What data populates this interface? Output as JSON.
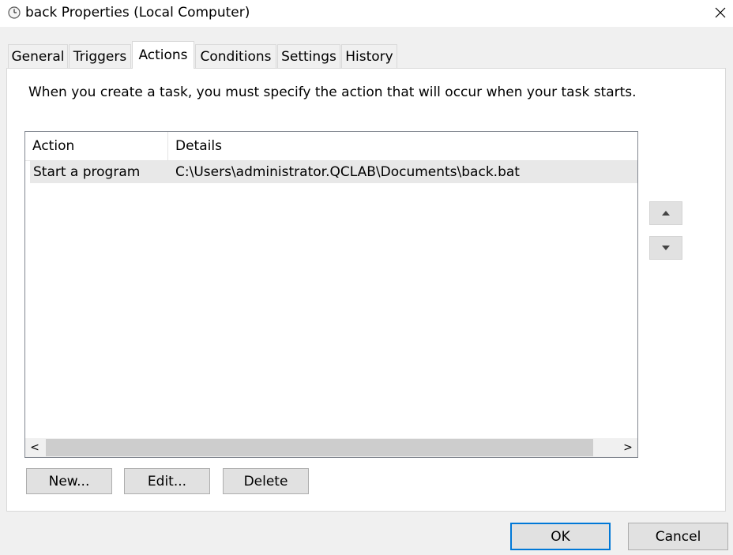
{
  "window": {
    "title": "back Properties (Local Computer)",
    "close_glyph": "✕"
  },
  "tabs": [
    {
      "label": "General"
    },
    {
      "label": "Triggers"
    },
    {
      "label": "Actions",
      "active": true
    },
    {
      "label": "Conditions"
    },
    {
      "label": "Settings"
    },
    {
      "label": "History"
    }
  ],
  "panel": {
    "description": "When you create a task, you must specify the action that will occur when your task starts."
  },
  "actions_list": {
    "columns": [
      "Action",
      "Details"
    ],
    "rows": [
      {
        "action": "Start a program",
        "details": "C:\\Users\\administrator.QCLAB\\Documents\\back.bat"
      }
    ],
    "scroll_left_glyph": "<",
    "scroll_right_glyph": ">"
  },
  "buttons": {
    "new": "New...",
    "edit": "Edit...",
    "delete": "Delete",
    "ok": "OK",
    "cancel": "Cancel"
  },
  "icons": {
    "title": "clock-icon",
    "move_up": "triangle-up-icon",
    "move_down": "triangle-down-icon"
  },
  "colors": {
    "accent": "#0078d7"
  }
}
